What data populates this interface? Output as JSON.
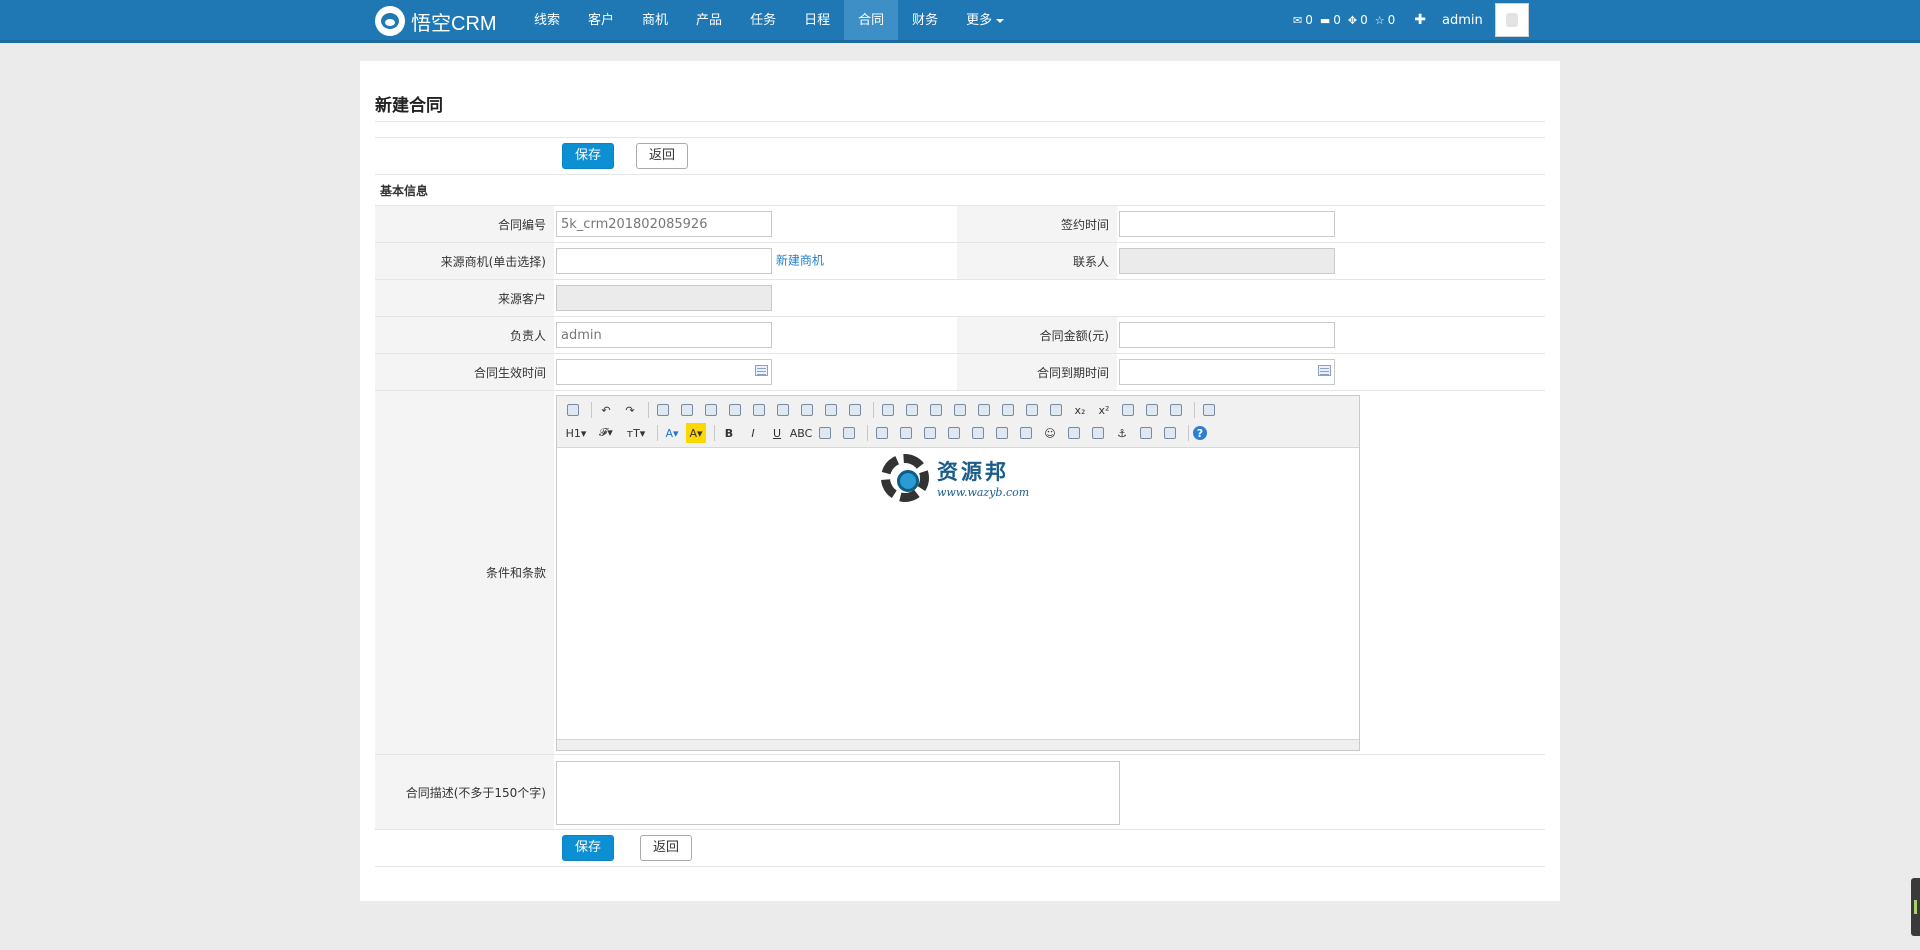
{
  "navbar": {
    "brand": "悟空CRM",
    "items": [
      "线索",
      "客户",
      "商机",
      "产品",
      "任务",
      "日程",
      "合同",
      "财务",
      "更多"
    ],
    "active_index": 6,
    "stats": [
      {
        "icon": "mail-icon",
        "glyph": "✉",
        "count": "0"
      },
      {
        "icon": "comment-icon",
        "glyph": "▬",
        "count": "0"
      },
      {
        "icon": "task-icon",
        "glyph": "✥",
        "count": "0"
      },
      {
        "icon": "star-icon",
        "glyph": "☆",
        "count": "0"
      }
    ],
    "plus": "✚",
    "user": "admin"
  },
  "page": {
    "title": "新建合同",
    "save_label": "保存",
    "back_label": "返回",
    "section_label": "基本信息"
  },
  "form": {
    "contract_no": {
      "label": "合同编号",
      "value": "5k_crm201802085926"
    },
    "sign_date": {
      "label": "签约时间",
      "value": ""
    },
    "source_opp": {
      "label": "来源商机(单击选择)",
      "value": "",
      "link": "新建商机"
    },
    "contact": {
      "label": "联系人",
      "value": ""
    },
    "source_customer": {
      "label": "来源客户",
      "value": ""
    },
    "owner": {
      "label": "负责人",
      "value": "admin"
    },
    "amount": {
      "label": "合同金额(元)",
      "value": ""
    },
    "start_date": {
      "label": "合同生效时间",
      "value": ""
    },
    "end_date": {
      "label": "合同到期时间",
      "value": ""
    },
    "terms": {
      "label": "条件和条款"
    },
    "description": {
      "label": "合同描述(不多于150个字)",
      "value": ""
    }
  },
  "editor": {
    "row1": [
      "source-icon",
      "sep",
      "undo-icon",
      "redo-icon",
      "sep",
      "preview-icon",
      "print-icon",
      "template-icon",
      "code-icon",
      "cut-icon",
      "copy-icon",
      "paste-icon",
      "paste-text-icon",
      "paste-word-icon",
      "sep",
      "align-left-icon",
      "align-center-icon",
      "align-right-icon",
      "justify-icon",
      "ordered-list-icon",
      "unordered-list-icon",
      "indent-icon",
      "outdent-icon",
      "subscript-icon",
      "superscript-icon",
      "clear-html-icon",
      "quick-format-icon",
      "select-all-icon",
      "sep",
      "fullscreen-icon"
    ],
    "row2": [
      "heading-icon",
      "font-name-icon",
      "font-size-icon",
      "sep",
      "fore-color-icon",
      "hilite-color-icon",
      "sep",
      "bold-icon",
      "italic-icon",
      "underline-icon",
      "strikethrough-icon",
      "line-height-icon",
      "remove-format-icon",
      "sep",
      "image-icon",
      "multi-image-icon",
      "flash-icon",
      "media-icon",
      "insert-file-icon",
      "table-icon",
      "hr-icon",
      "emoticon-icon",
      "baidu-map-icon",
      "page-break-icon",
      "anchor-icon",
      "link-icon",
      "unlink-icon",
      "sep",
      "about-icon"
    ],
    "glyphs": {
      "heading-icon": "H1▾",
      "font-name-icon": "𝓕▾",
      "font-size-icon": "тT▾",
      "fore-color-icon": "A▾",
      "hilite-color-icon": "A▾",
      "bold-icon": "B",
      "italic-icon": "I",
      "underline-icon": "U",
      "strikethrough-icon": "ABC",
      "subscript-icon": "x₂",
      "superscript-icon": "x²",
      "undo-icon": "↶",
      "redo-icon": "↷",
      "about-icon": "?",
      "anchor-icon": "⚓",
      "emoticon-icon": "☺"
    },
    "watermark_cn": "资源邦",
    "watermark_en": "www.wazyb.com"
  }
}
